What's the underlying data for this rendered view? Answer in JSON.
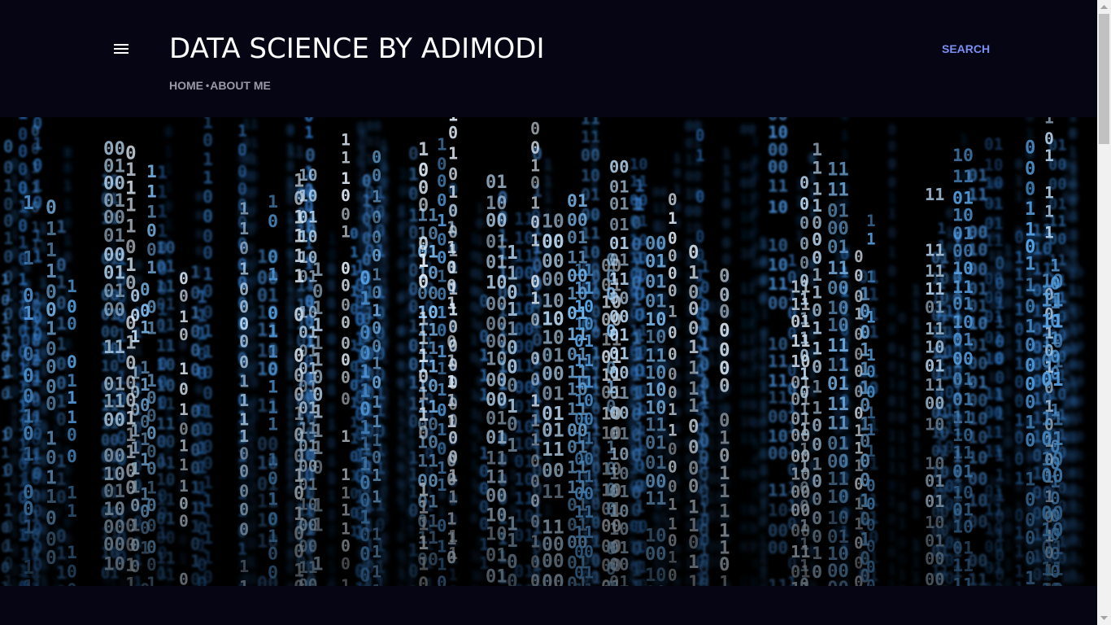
{
  "header": {
    "menu_icon": "hamburger-menu-icon",
    "blog_title": "DATA SCIENCE BY ADIMODI",
    "search_label": "SEARCH"
  },
  "nav": {
    "items": [
      {
        "label": "HOME"
      },
      {
        "label": "ABOUT ME"
      }
    ],
    "separator": "•"
  },
  "banner": {
    "image": "binary-code-rain-image",
    "glyphs": [
      "0",
      "1"
    ]
  },
  "colors": {
    "background": "#050514",
    "title": "#ffffff",
    "search": "#7c8ef2",
    "nav": "#9a9aa6",
    "binary_blue": "#3d8fe0"
  }
}
